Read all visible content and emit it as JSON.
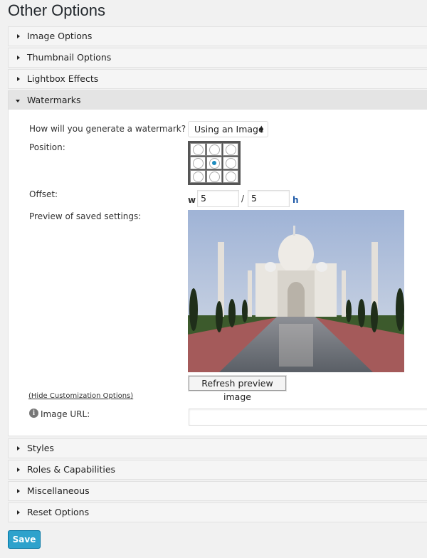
{
  "page_title": "Other Options",
  "sections_top": [
    {
      "label": "Image Options"
    },
    {
      "label": "Thumbnail Options"
    },
    {
      "label": "Lightbox Effects"
    }
  ],
  "watermarks": {
    "label": "Watermarks",
    "method_label": "How will you generate a watermark?",
    "method_value": "Using an Image",
    "position_label": "Position:",
    "position_selected": "middle-center",
    "offset_label": "Offset:",
    "offset_w_prefix": "w",
    "offset_w": "5",
    "offset_sep": "/",
    "offset_h": "5",
    "offset_h_suffix": "h",
    "preview_label": "Preview of saved settings:",
    "refresh_label": "Refresh preview image",
    "hide_link": "(Hide Customization Options)",
    "image_url_label": "Image URL:",
    "image_url_value": ""
  },
  "sections_bottom": [
    {
      "label": "Styles"
    },
    {
      "label": "Roles & Capabilities"
    },
    {
      "label": "Miscellaneous"
    },
    {
      "label": "Reset Options"
    }
  ],
  "save_label": "Save",
  "colors": {
    "accent": "#2ea2cc",
    "radio": "#1e8cbe"
  }
}
